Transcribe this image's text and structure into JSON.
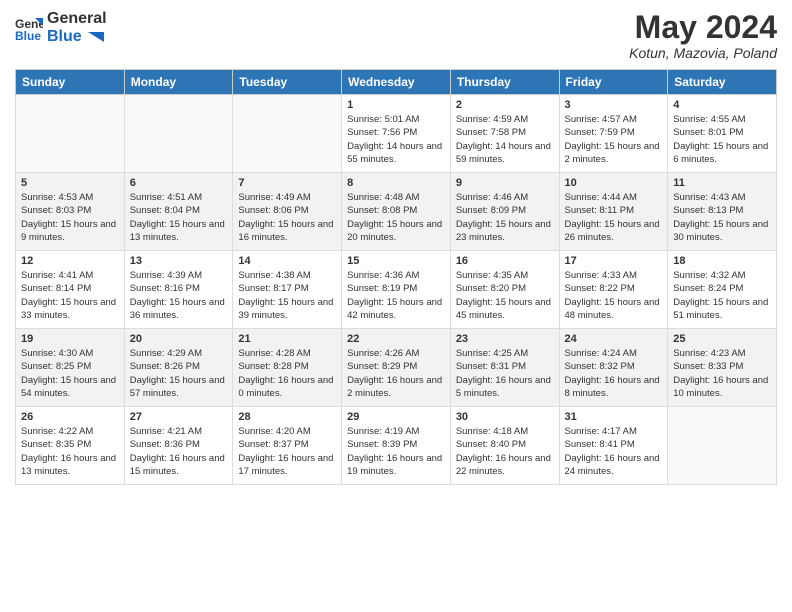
{
  "header": {
    "logo_general": "General",
    "logo_blue": "Blue",
    "title": "May 2024",
    "subtitle": "Kotun, Mazovia, Poland"
  },
  "days_of_week": [
    "Sunday",
    "Monday",
    "Tuesday",
    "Wednesday",
    "Thursday",
    "Friday",
    "Saturday"
  ],
  "weeks": [
    [
      {
        "day": "",
        "info": ""
      },
      {
        "day": "",
        "info": ""
      },
      {
        "day": "",
        "info": ""
      },
      {
        "day": "1",
        "sunrise": "Sunrise: 5:01 AM",
        "sunset": "Sunset: 7:56 PM",
        "daylight": "Daylight: 14 hours and 55 minutes."
      },
      {
        "day": "2",
        "sunrise": "Sunrise: 4:59 AM",
        "sunset": "Sunset: 7:58 PM",
        "daylight": "Daylight: 14 hours and 59 minutes."
      },
      {
        "day": "3",
        "sunrise": "Sunrise: 4:57 AM",
        "sunset": "Sunset: 7:59 PM",
        "daylight": "Daylight: 15 hours and 2 minutes."
      },
      {
        "day": "4",
        "sunrise": "Sunrise: 4:55 AM",
        "sunset": "Sunset: 8:01 PM",
        "daylight": "Daylight: 15 hours and 6 minutes."
      }
    ],
    [
      {
        "day": "5",
        "sunrise": "Sunrise: 4:53 AM",
        "sunset": "Sunset: 8:03 PM",
        "daylight": "Daylight: 15 hours and 9 minutes."
      },
      {
        "day": "6",
        "sunrise": "Sunrise: 4:51 AM",
        "sunset": "Sunset: 8:04 PM",
        "daylight": "Daylight: 15 hours and 13 minutes."
      },
      {
        "day": "7",
        "sunrise": "Sunrise: 4:49 AM",
        "sunset": "Sunset: 8:06 PM",
        "daylight": "Daylight: 15 hours and 16 minutes."
      },
      {
        "day": "8",
        "sunrise": "Sunrise: 4:48 AM",
        "sunset": "Sunset: 8:08 PM",
        "daylight": "Daylight: 15 hours and 20 minutes."
      },
      {
        "day": "9",
        "sunrise": "Sunrise: 4:46 AM",
        "sunset": "Sunset: 8:09 PM",
        "daylight": "Daylight: 15 hours and 23 minutes."
      },
      {
        "day": "10",
        "sunrise": "Sunrise: 4:44 AM",
        "sunset": "Sunset: 8:11 PM",
        "daylight": "Daylight: 15 hours and 26 minutes."
      },
      {
        "day": "11",
        "sunrise": "Sunrise: 4:43 AM",
        "sunset": "Sunset: 8:13 PM",
        "daylight": "Daylight: 15 hours and 30 minutes."
      }
    ],
    [
      {
        "day": "12",
        "sunrise": "Sunrise: 4:41 AM",
        "sunset": "Sunset: 8:14 PM",
        "daylight": "Daylight: 15 hours and 33 minutes."
      },
      {
        "day": "13",
        "sunrise": "Sunrise: 4:39 AM",
        "sunset": "Sunset: 8:16 PM",
        "daylight": "Daylight: 15 hours and 36 minutes."
      },
      {
        "day": "14",
        "sunrise": "Sunrise: 4:38 AM",
        "sunset": "Sunset: 8:17 PM",
        "daylight": "Daylight: 15 hours and 39 minutes."
      },
      {
        "day": "15",
        "sunrise": "Sunrise: 4:36 AM",
        "sunset": "Sunset: 8:19 PM",
        "daylight": "Daylight: 15 hours and 42 minutes."
      },
      {
        "day": "16",
        "sunrise": "Sunrise: 4:35 AM",
        "sunset": "Sunset: 8:20 PM",
        "daylight": "Daylight: 15 hours and 45 minutes."
      },
      {
        "day": "17",
        "sunrise": "Sunrise: 4:33 AM",
        "sunset": "Sunset: 8:22 PM",
        "daylight": "Daylight: 15 hours and 48 minutes."
      },
      {
        "day": "18",
        "sunrise": "Sunrise: 4:32 AM",
        "sunset": "Sunset: 8:24 PM",
        "daylight": "Daylight: 15 hours and 51 minutes."
      }
    ],
    [
      {
        "day": "19",
        "sunrise": "Sunrise: 4:30 AM",
        "sunset": "Sunset: 8:25 PM",
        "daylight": "Daylight: 15 hours and 54 minutes."
      },
      {
        "day": "20",
        "sunrise": "Sunrise: 4:29 AM",
        "sunset": "Sunset: 8:26 PM",
        "daylight": "Daylight: 15 hours and 57 minutes."
      },
      {
        "day": "21",
        "sunrise": "Sunrise: 4:28 AM",
        "sunset": "Sunset: 8:28 PM",
        "daylight": "Daylight: 16 hours and 0 minutes."
      },
      {
        "day": "22",
        "sunrise": "Sunrise: 4:26 AM",
        "sunset": "Sunset: 8:29 PM",
        "daylight": "Daylight: 16 hours and 2 minutes."
      },
      {
        "day": "23",
        "sunrise": "Sunrise: 4:25 AM",
        "sunset": "Sunset: 8:31 PM",
        "daylight": "Daylight: 16 hours and 5 minutes."
      },
      {
        "day": "24",
        "sunrise": "Sunrise: 4:24 AM",
        "sunset": "Sunset: 8:32 PM",
        "daylight": "Daylight: 16 hours and 8 minutes."
      },
      {
        "day": "25",
        "sunrise": "Sunrise: 4:23 AM",
        "sunset": "Sunset: 8:33 PM",
        "daylight": "Daylight: 16 hours and 10 minutes."
      }
    ],
    [
      {
        "day": "26",
        "sunrise": "Sunrise: 4:22 AM",
        "sunset": "Sunset: 8:35 PM",
        "daylight": "Daylight: 16 hours and 13 minutes."
      },
      {
        "day": "27",
        "sunrise": "Sunrise: 4:21 AM",
        "sunset": "Sunset: 8:36 PM",
        "daylight": "Daylight: 16 hours and 15 minutes."
      },
      {
        "day": "28",
        "sunrise": "Sunrise: 4:20 AM",
        "sunset": "Sunset: 8:37 PM",
        "daylight": "Daylight: 16 hours and 17 minutes."
      },
      {
        "day": "29",
        "sunrise": "Sunrise: 4:19 AM",
        "sunset": "Sunset: 8:39 PM",
        "daylight": "Daylight: 16 hours and 19 minutes."
      },
      {
        "day": "30",
        "sunrise": "Sunrise: 4:18 AM",
        "sunset": "Sunset: 8:40 PM",
        "daylight": "Daylight: 16 hours and 22 minutes."
      },
      {
        "day": "31",
        "sunrise": "Sunrise: 4:17 AM",
        "sunset": "Sunset: 8:41 PM",
        "daylight": "Daylight: 16 hours and 24 minutes."
      },
      {
        "day": "",
        "info": ""
      }
    ]
  ]
}
